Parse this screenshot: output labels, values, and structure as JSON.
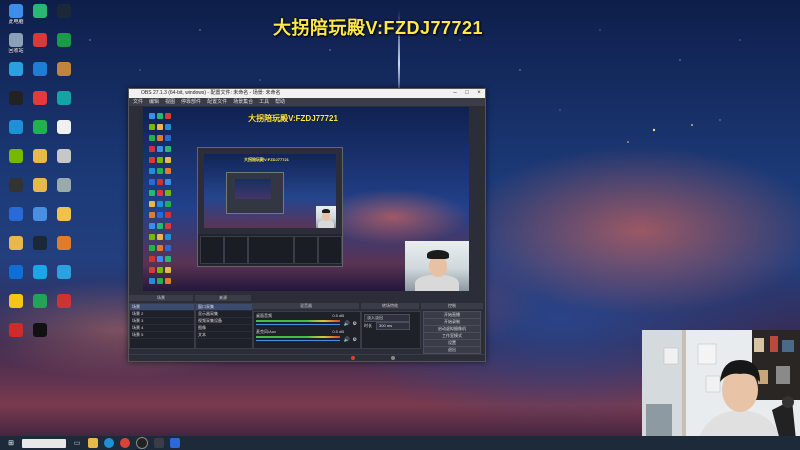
{
  "stream_headline": "大拐陪玩殿V:FZDJ77721",
  "desktop": {
    "icons": [
      {
        "label": "此电脑",
        "icon": "pc-icon",
        "color": "#3d8ee8"
      },
      {
        "label": "",
        "icon": "app-green-icon",
        "color": "#2ab673"
      },
      {
        "label": "",
        "icon": "steam-icon",
        "color": "#1b2838"
      },
      {
        "label": "回收站",
        "icon": "recycle-bin-icon",
        "color": "#8aa2b8"
      },
      {
        "label": "",
        "icon": "red-app-icon",
        "color": "#d63a3a"
      },
      {
        "label": "",
        "icon": "green-app-icon",
        "color": "#1a9b4a"
      },
      {
        "label": "",
        "icon": "monitor-app-icon",
        "color": "#2aa0e0"
      },
      {
        "label": "",
        "icon": "cloud-app-icon",
        "color": "#1e7ed6"
      },
      {
        "label": "",
        "icon": "game-app-icon",
        "color": "#c0843e"
      },
      {
        "label": "",
        "icon": "logitech-icon",
        "color": "#222"
      },
      {
        "label": "",
        "icon": "netease-music-icon",
        "color": "#e33b3b"
      },
      {
        "label": "",
        "icon": "teal-app-icon",
        "color": "#16a3a3"
      },
      {
        "label": "",
        "icon": "edge-icon",
        "color": "#1f8fd6"
      },
      {
        "label": "",
        "icon": "wechat-icon",
        "color": "#22b14c"
      },
      {
        "label": "",
        "icon": "document-icon",
        "color": "#f0f0f0"
      },
      {
        "label": "",
        "icon": "nvidia-icon",
        "color": "#76b900"
      },
      {
        "label": "",
        "icon": "folder-icon",
        "color": "#e8b84a"
      },
      {
        "label": "",
        "icon": "shortcut-icon",
        "color": "#c7c7c7"
      },
      {
        "label": "",
        "icon": "app-dark-icon",
        "color": "#333"
      },
      {
        "label": "",
        "icon": "folder-icon",
        "color": "#e8b84a"
      },
      {
        "label": "",
        "icon": "blank-icon",
        "color": "#9aa"
      },
      {
        "label": "",
        "icon": "app-blue-icon",
        "color": "#2a6ad6"
      },
      {
        "label": "",
        "icon": "phone-icon",
        "color": "#4a90e2"
      },
      {
        "label": "",
        "icon": "folder-icon",
        "color": "#f0c14b"
      },
      {
        "label": "",
        "icon": "folder-icon",
        "color": "#e8b84a"
      },
      {
        "label": "",
        "icon": "steam-icon",
        "color": "#1b2838"
      },
      {
        "label": "",
        "icon": "orange-app-icon",
        "color": "#e07b2a"
      },
      {
        "label": "",
        "icon": "mail-icon",
        "color": "#0f6fd6"
      },
      {
        "label": "",
        "icon": "chat-app-icon",
        "color": "#1aa6e8"
      },
      {
        "label": "",
        "icon": "globe-icon",
        "color": "#2da1e0"
      },
      {
        "label": "",
        "icon": "chart-app-icon",
        "color": "#f5c518"
      },
      {
        "label": "",
        "icon": "app-green-icon",
        "color": "#22a35a"
      },
      {
        "label": "",
        "icon": "flag-icon",
        "color": "#c33"
      },
      {
        "label": "",
        "icon": "red-app-icon",
        "color": "#d02a2a"
      },
      {
        "label": "",
        "icon": "tiktok-icon",
        "color": "#111"
      }
    ]
  },
  "obs": {
    "title": "OBS 27.1.3 (64-bit, windows) - 配置文件: 未命名 - 场景: 未命名",
    "menu": [
      "文件",
      "编辑",
      "视图",
      "停靠部件",
      "配置文件",
      "场景集合",
      "工具",
      "帮助"
    ],
    "preview_title": "大拐陪玩殿V:FZDJ77721",
    "docks": {
      "scenes_header": "场景",
      "sources_header": "来源",
      "mixer_header": "混音器",
      "transitions_header": "转场特效",
      "controls_header": "控制"
    },
    "scenes": [
      "场景",
      "场景 2",
      "场景 3",
      "场景 4",
      "场景 5"
    ],
    "sources": [
      "窗口采集",
      "显示器采集",
      "视频采集设备",
      "图像",
      "文本"
    ],
    "mixer": [
      {
        "name": "桌面音频",
        "level": "0.0 dB"
      },
      {
        "name": "麦克风/Aux",
        "level": "0.0 dB"
      }
    ],
    "transition": {
      "type": "淡入淡出",
      "duration_label": "时长",
      "duration": "300 ms"
    },
    "controls": [
      "开始直播",
      "开始录制",
      "启动虚拟摄像机",
      "工作室模式",
      "设置",
      "退出"
    ]
  },
  "taskbar": {
    "items": [
      "start-icon",
      "search-box",
      "task-view-icon",
      "explorer-icon",
      "edge-icon",
      "chrome-icon",
      "obs-icon",
      "app-icon",
      "app-icon"
    ]
  }
}
